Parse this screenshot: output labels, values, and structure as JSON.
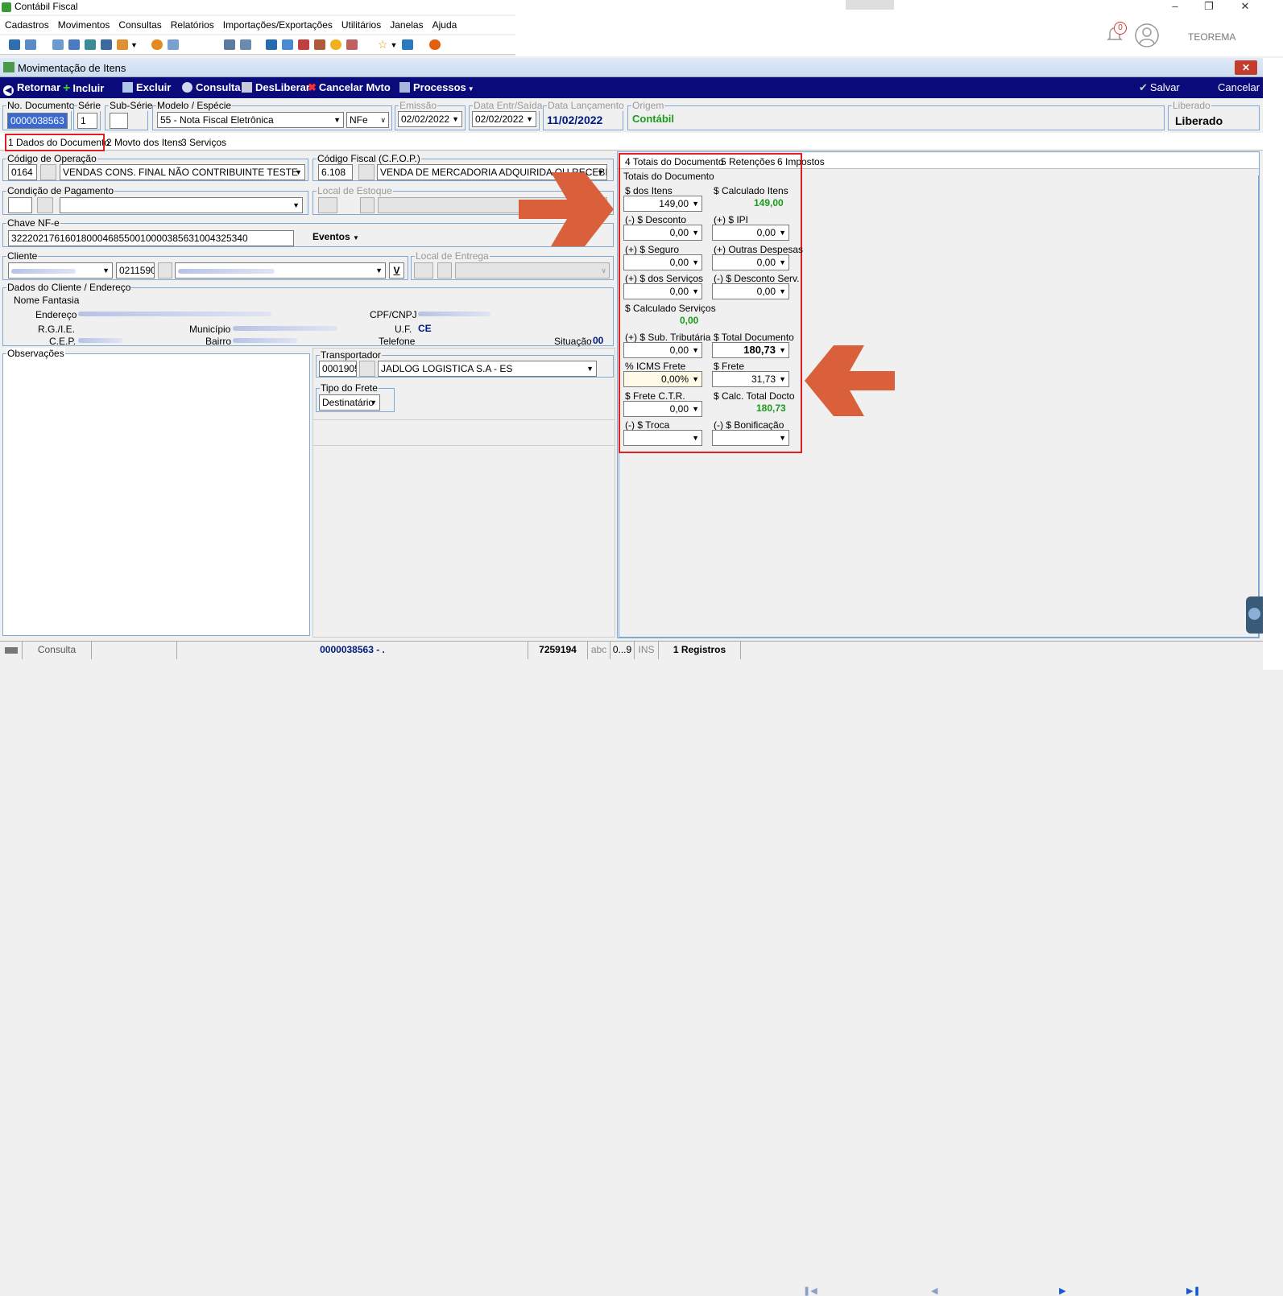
{
  "app": {
    "title": "Contábil Fiscal"
  },
  "menu": [
    "Cadastros",
    "Movimentos",
    "Consultas",
    "Relatórios",
    "Importações/Exportações",
    "Utilitários",
    "Janelas",
    "Ajuda"
  ],
  "header": {
    "notification_count": "0",
    "user": "TEOREMA"
  },
  "subwindow": {
    "title": "Movimentação de Itens"
  },
  "actions": {
    "retornar": "Retornar",
    "incluir": "Incluir",
    "excluir": "Excluir",
    "consulta": "Consulta",
    "desliberar": "DesLiberar",
    "cancelar_mvto": "Cancelar Mvto",
    "processos": "Processos",
    "salvar": "Salvar",
    "cancelar": "Cancelar"
  },
  "doc": {
    "numero_label": "No. Documento",
    "numero": "0000038563",
    "serie_label": "Série",
    "serie": "1",
    "subserie_label": "Sub-Série",
    "modelo_label": "Modelo / Espécie",
    "modelo": "55 - Nota Fiscal Eletrônica",
    "especie": "NFe",
    "emissao_label": "Emissão",
    "emissao": "02/02/2022",
    "data_entr_label": "Data Entr/Saída",
    "data_entr": "02/02/2022",
    "data_lanc_label": "Data Lançamento",
    "data_lanc": "11/02/2022",
    "origem_label": "Origem",
    "origem": "Contábil",
    "liberado_label": "Liberado",
    "liberado": "Liberado"
  },
  "tabs_left": [
    "1 Dados do Documento",
    "2 Movto dos Itens",
    "3 Serviços"
  ],
  "operacao": {
    "label": "Código de Operação",
    "codigo": "0164",
    "descricao": "VENDAS  CONS. FINAL NÃO CONTRIBUINTE TESTE"
  },
  "cfop": {
    "label": "Código Fiscal (C.F.O.P.)",
    "codigo": "6.108",
    "descricao": "VENDA DE MERCADORIA ADQUIRIDA OU RECEBIDA"
  },
  "pagamento": {
    "label": "Condição de Pagamento"
  },
  "estoque": {
    "label": "Local de Estoque"
  },
  "chave": {
    "label": "Chave NF-e",
    "valor": "32220217616018000468550010000385631004325340",
    "eventos": "Eventos"
  },
  "cliente": {
    "label": "Cliente",
    "codigo": "0211590",
    "btn": "V"
  },
  "entrega": {
    "label": "Local de Entrega"
  },
  "dados_cliente": {
    "label": "Dados do Cliente  / Endereço",
    "nome_fantasia": "Nome Fantasia",
    "endereco": "Endereço",
    "rg": "R.G./I.E.",
    "cep": "C.E.P.",
    "municipio": "Município",
    "bairro": "Bairro",
    "cpf": "CPF/CNPJ",
    "uf": "U.F.",
    "uf_valor": "CE",
    "telefone": "Telefone",
    "situacao": "Situação",
    "situacao_valor": "00"
  },
  "observacoes": {
    "label": "Observações"
  },
  "transportador": {
    "label": "Transportador",
    "codigo": "0001905",
    "nome": "JADLOG LOGISTICA S.A - ES"
  },
  "frete": {
    "label": "Tipo do Frete",
    "valor": "Destinatário"
  },
  "tabs_right": [
    "4 Totais do Documento",
    "5 Retenções",
    "6 Impostos"
  ],
  "totais": {
    "group_label": "Totais do Documento",
    "dos_itens_label": "$ dos Itens",
    "dos_itens": "149,00",
    "calc_itens_label": "$ Calculado Itens",
    "calc_itens": "149,00",
    "desconto_label": "(-) $ Desconto",
    "desconto": "0,00",
    "ipi_label": "(+) $ IPI",
    "ipi": "0,00",
    "seguro_label": "(+) $ Seguro",
    "seguro": "0,00",
    "outras_label": "(+) Outras Despesas",
    "outras": "0,00",
    "servicos_label": "(+) $ dos Serviços",
    "servicos": "0,00",
    "desc_serv_label": "(-) $ Desconto Serv.",
    "desc_serv": "0,00",
    "calc_serv_label": "$ Calculado Serviços",
    "calc_serv": "0,00",
    "sub_trib_label": "(+) $ Sub. Tributária",
    "sub_trib": "0,00",
    "total_doc_label": "$ Total Documento",
    "total_doc": "180,73",
    "icms_frete_label": "% ICMS Frete",
    "icms_frete": "0,00%",
    "frete_label": "$ Frete",
    "frete": "31,73",
    "frete_ctr_label": "$ Frete C.T.R.",
    "frete_ctr": "0,00",
    "calc_total_label": "$ Calc. Total Docto",
    "calc_total": "180,73",
    "troca_label": "(-) $ Troca",
    "bonificacao_label": "(-) $ Bonificação"
  },
  "status": {
    "mode": "Consulta",
    "doc": "0000038563 - .",
    "code": "7259194",
    "abc": "abc",
    "num": "0...9",
    "ins": "INS",
    "registros": "1 Registros"
  },
  "colors": {
    "accent": "#0a0a7a",
    "annotation": "#d9603a",
    "highlight": "#e02020",
    "positive": "#1a9a1a"
  }
}
